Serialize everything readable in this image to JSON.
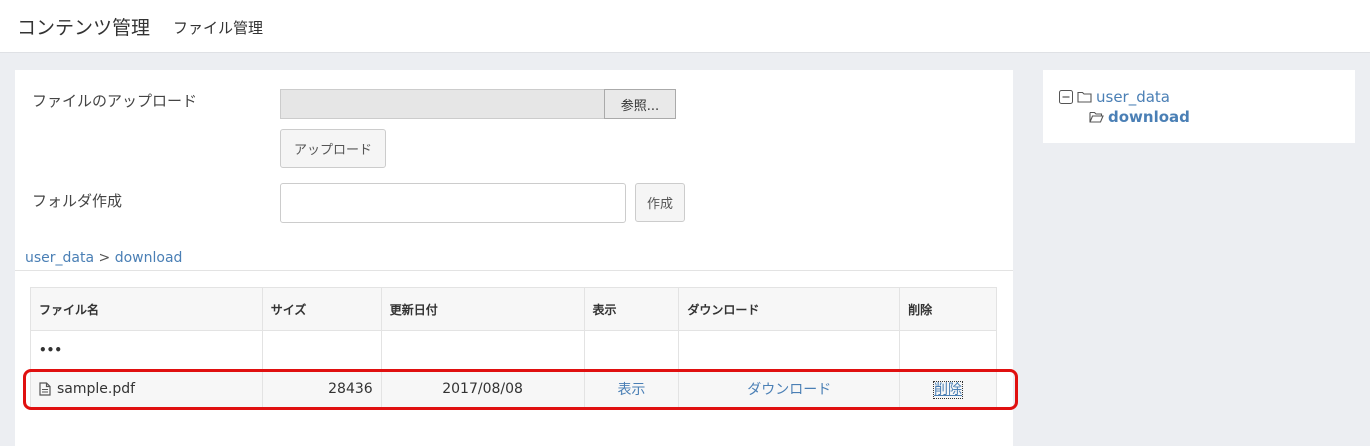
{
  "header": {
    "title": "コンテンツ管理",
    "subtitle": "ファイル管理"
  },
  "upload": {
    "label": "ファイルのアップロード",
    "browse_label": "参照...",
    "upload_label": "アップロード"
  },
  "folder": {
    "label": "フォルダ作成",
    "input_value": "",
    "create_label": "作成"
  },
  "breadcrumb": {
    "root": "user_data",
    "separator": ">",
    "current": "download"
  },
  "table": {
    "headers": [
      "ファイル名",
      "サイズ",
      "更新日付",
      "表示",
      "ダウンロード",
      "削除"
    ],
    "parent_row": "•••",
    "rows": [
      {
        "name": "sample.pdf",
        "size": "28436",
        "date": "2017/08/08",
        "view": "表示",
        "download": "ダウンロード",
        "delete": "削除"
      }
    ]
  },
  "tree": {
    "root": "user_data",
    "child": "download"
  },
  "colors": {
    "link": "#4a7fb5",
    "highlight": "#e01010",
    "background": "#eceef2"
  }
}
